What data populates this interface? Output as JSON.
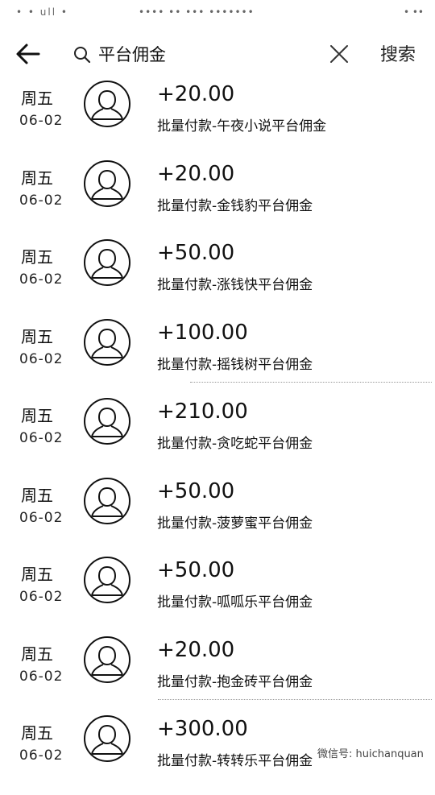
{
  "status_bar": {
    "left": "• • ull •",
    "middle": "•••• •• ••• •••••••",
    "right": "• ••"
  },
  "header": {
    "search_value": "平台佣金",
    "search_button": "搜索"
  },
  "icons": {
    "back": "arrow-left-icon",
    "search": "search-icon",
    "clear": "close-icon",
    "avatar": "user-avatar-icon"
  },
  "rows": [
    {
      "day": "周五",
      "date": "06-02",
      "amount": "+20.00",
      "desc": "批量付款-午夜小说平台佣金"
    },
    {
      "day": "周五",
      "date": "06-02",
      "amount": "+20.00",
      "desc": "批量付款-金钱豹平台佣金"
    },
    {
      "day": "周五",
      "date": "06-02",
      "amount": "+50.00",
      "desc": "批量付款-涨钱快平台佣金"
    },
    {
      "day": "周五",
      "date": "06-02",
      "amount": "+100.00",
      "desc": "批量付款-摇钱树平台佣金"
    },
    {
      "day": "周五",
      "date": "06-02",
      "amount": "+210.00",
      "desc": "批量付款-贪吃蛇平台佣金"
    },
    {
      "day": "周五",
      "date": "06-02",
      "amount": "+50.00",
      "desc": "批量付款-菠萝蜜平台佣金"
    },
    {
      "day": "周五",
      "date": "06-02",
      "amount": "+50.00",
      "desc": "批量付款-呱呱乐平台佣金"
    },
    {
      "day": "周五",
      "date": "06-02",
      "amount": "+20.00",
      "desc": "批量付款-抱金砖平台佣金"
    },
    {
      "day": "周五",
      "date": "06-02",
      "amount": "+300.00",
      "desc": "批量付款-转转乐平台佣金"
    }
  ],
  "watermark": "微信号: huichanquan"
}
